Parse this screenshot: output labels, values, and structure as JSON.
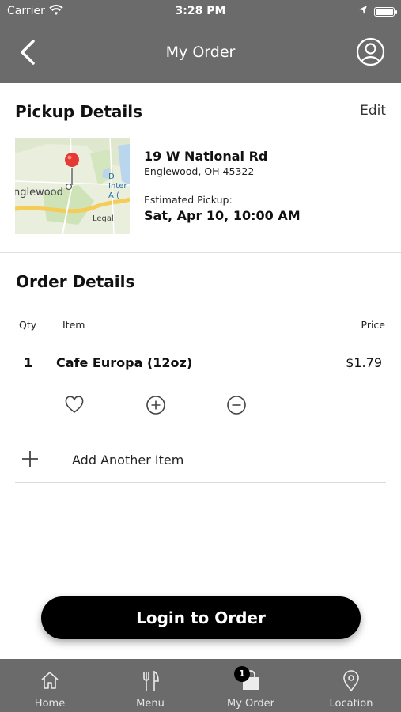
{
  "status_bar": {
    "carrier": "Carrier",
    "time": "3:28 PM"
  },
  "nav": {
    "title": "My Order"
  },
  "pickup": {
    "title": "Pickup Details",
    "edit_label": "Edit",
    "address_line1": "19 W National Rd",
    "address_line2": "Englewood, OH 45322",
    "estimated_label": "Estimated Pickup:",
    "estimated_value": "Sat, Apr 10, 10:00 AM",
    "map": {
      "place_label": "nglewood",
      "legal_label": "Legal",
      "side_label": "D Inter A ("
    }
  },
  "order": {
    "title": "Order Details",
    "columns": {
      "qty": "Qty",
      "item": "Item",
      "price": "Price"
    },
    "items": [
      {
        "qty": "1",
        "name": "Cafe Europa  (12oz)",
        "price": "$1.79"
      }
    ],
    "add_item_label": "Add Another Item"
  },
  "cta": {
    "label": "Login to Order"
  },
  "tabbar": {
    "tabs": [
      {
        "label": "Home",
        "icon": "home-icon"
      },
      {
        "label": "Menu",
        "icon": "fork-knife-icon"
      },
      {
        "label": "My Order",
        "icon": "shopping-bag-icon",
        "badge": "1"
      },
      {
        "label": "Location",
        "icon": "location-pin-icon"
      }
    ]
  },
  "colors": {
    "header_bg": "#6b6b6b",
    "cta_bg": "#000000",
    "map_pin": "#e53935"
  }
}
